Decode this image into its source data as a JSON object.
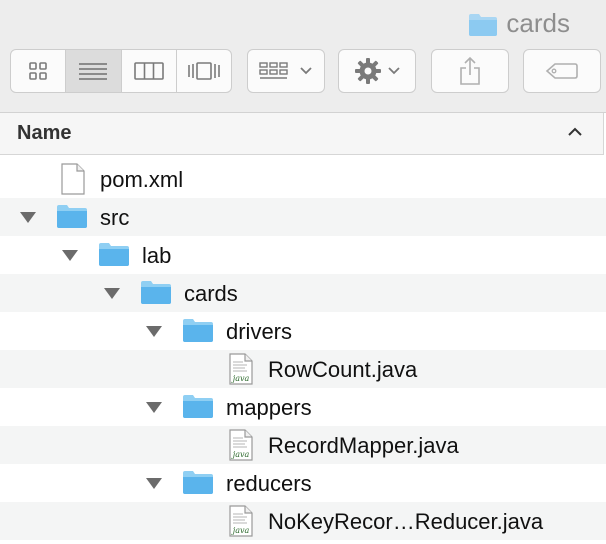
{
  "window": {
    "title": "cards",
    "title_icon": "folder-icon"
  },
  "toolbar": {
    "view_buttons": [
      {
        "name": "icon-view",
        "icon": "grid-icon",
        "selected": false
      },
      {
        "name": "list-view",
        "icon": "list-icon",
        "selected": true
      },
      {
        "name": "column-view",
        "icon": "columns-icon",
        "selected": false
      },
      {
        "name": "gallery-view",
        "icon": "coverflow-icon",
        "selected": false
      }
    ],
    "group_button_icon": "group-by-icon",
    "action_button_icon": "gear-icon",
    "share_button_icon": "share-icon",
    "tags_button_icon": "tag-icon"
  },
  "header": {
    "name_column": "Name",
    "sort_indicator": "chevron-up-icon"
  },
  "files": [
    {
      "name": "pom.xml",
      "kind": "document",
      "depth": 0,
      "expandable": false
    },
    {
      "name": "src",
      "kind": "folder",
      "depth": 0,
      "expandable": true,
      "expanded": true
    },
    {
      "name": "lab",
      "kind": "folder",
      "depth": 1,
      "expandable": true,
      "expanded": true
    },
    {
      "name": "cards",
      "kind": "folder",
      "depth": 2,
      "expandable": true,
      "expanded": true
    },
    {
      "name": "drivers",
      "kind": "folder",
      "depth": 3,
      "expandable": true,
      "expanded": true
    },
    {
      "name": "RowCount.java",
      "kind": "java",
      "depth": 4,
      "expandable": false
    },
    {
      "name": "mappers",
      "kind": "folder",
      "depth": 3,
      "expandable": true,
      "expanded": true
    },
    {
      "name": "RecordMapper.java",
      "kind": "java",
      "depth": 4,
      "expandable": false
    },
    {
      "name": "reducers",
      "kind": "folder",
      "depth": 3,
      "expandable": true,
      "expanded": true
    },
    {
      "name": "NoKeyRecor…Reducer.java",
      "kind": "java",
      "depth": 4,
      "expandable": false
    }
  ],
  "colors": {
    "folder": "#5ab4ec",
    "folder_tab": "#8fcff3",
    "selected_segment": "#dcdcdc",
    "alt_row": "#f4f5f5"
  }
}
